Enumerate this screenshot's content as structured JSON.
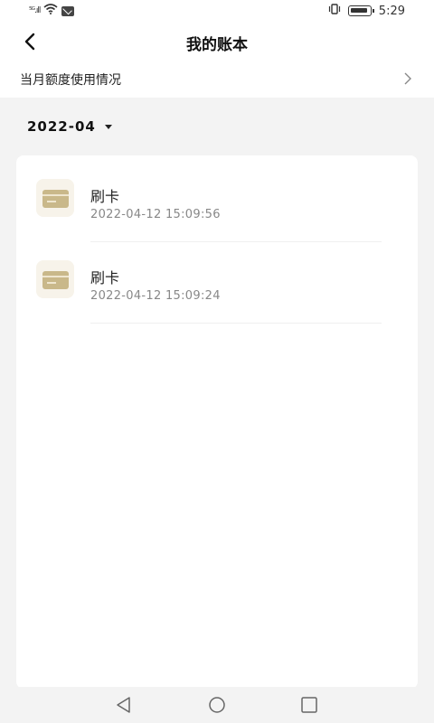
{
  "status_bar": {
    "signal": "⁵ᴳ.ıll",
    "time": "5:29"
  },
  "header": {
    "title": "我的账本"
  },
  "quota": {
    "label": "当月额度使用情况"
  },
  "filter": {
    "month": "2022-04"
  },
  "records": [
    {
      "title": "刷卡",
      "time": "2022-04-12 15:09:56",
      "icon": "card-icon"
    },
    {
      "title": "刷卡",
      "time": "2022-04-12 15:09:24",
      "icon": "card-icon"
    }
  ],
  "colors": {
    "accent": "#c9b88a",
    "background": "#f3f3f3"
  }
}
